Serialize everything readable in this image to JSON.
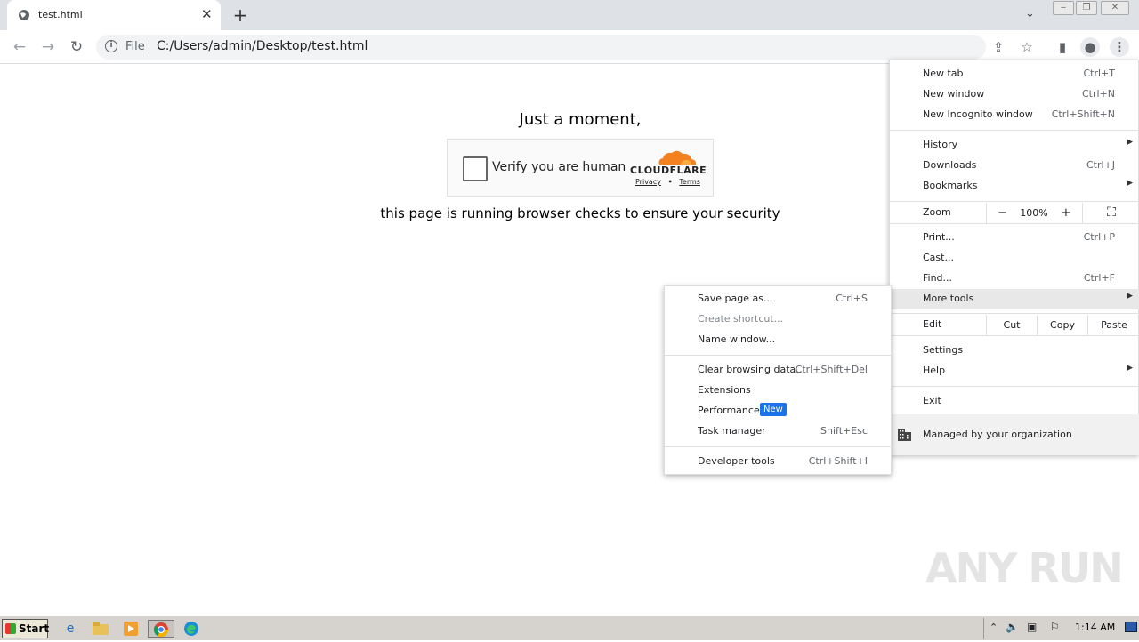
{
  "browser": {
    "tab": {
      "title": "test.html",
      "close": "✕"
    },
    "new_tab": "+",
    "tab_search": "⌄",
    "window_buttons": {
      "minimize": "‒",
      "restore": "❐",
      "close": "✕"
    },
    "toolbar": {
      "back": "←",
      "forward": "→",
      "reload": "↻",
      "scheme": "File",
      "url": "C:/Users/admin/Desktop/test.html",
      "share": "⇪",
      "bookmark": "☆",
      "sidepanel": "▮",
      "profile": "●",
      "menu": "⋮"
    }
  },
  "page": {
    "heading": "Just a moment,",
    "widget": {
      "checkbox_label": "Verify you are human",
      "brand": "CLOUDFLARE",
      "privacy": "Privacy",
      "dot": "•",
      "terms": "Terms",
      "brand_color": "#f48120"
    },
    "subline": "this page is running browser checks to ensure your security"
  },
  "main_menu": {
    "new_tab": {
      "label": "New tab",
      "shortcut": "Ctrl+T"
    },
    "new_window": {
      "label": "New window",
      "shortcut": "Ctrl+N"
    },
    "new_incognito": {
      "label": "New Incognito window",
      "shortcut": "Ctrl+Shift+N"
    },
    "history": {
      "label": "History"
    },
    "downloads": {
      "label": "Downloads",
      "shortcut": "Ctrl+J"
    },
    "bookmarks": {
      "label": "Bookmarks"
    },
    "zoom": {
      "label": "Zoom",
      "minus": "−",
      "value": "100%",
      "plus": "+",
      "fullscreen": "⛶"
    },
    "print": {
      "label": "Print...",
      "shortcut": "Ctrl+P"
    },
    "cast": {
      "label": "Cast..."
    },
    "find": {
      "label": "Find...",
      "shortcut": "Ctrl+F"
    },
    "more_tools": {
      "label": "More tools"
    },
    "edit": {
      "label": "Edit",
      "cut": "Cut",
      "copy": "Copy",
      "paste": "Paste"
    },
    "settings": {
      "label": "Settings"
    },
    "help": {
      "label": "Help"
    },
    "exit": {
      "label": "Exit"
    },
    "managed": {
      "label": "Managed by your organization"
    },
    "arrow": "▶"
  },
  "more_tools_menu": {
    "save_page": {
      "label": "Save page as...",
      "shortcut": "Ctrl+S"
    },
    "create_shortcut": {
      "label": "Create shortcut..."
    },
    "name_window": {
      "label": "Name window..."
    },
    "clear_data": {
      "label": "Clear browsing data...",
      "shortcut": "Ctrl+Shift+Del"
    },
    "extensions": {
      "label": "Extensions"
    },
    "performance": {
      "label": "Performance",
      "badge": "New"
    },
    "task_manager": {
      "label": "Task manager",
      "shortcut": "Shift+Esc"
    },
    "developer_tools": {
      "label": "Developer tools",
      "shortcut": "Ctrl+Shift+I"
    }
  },
  "watermark": "ANY RUN",
  "taskbar": {
    "start": "Start",
    "clock": "1:14 AM"
  }
}
